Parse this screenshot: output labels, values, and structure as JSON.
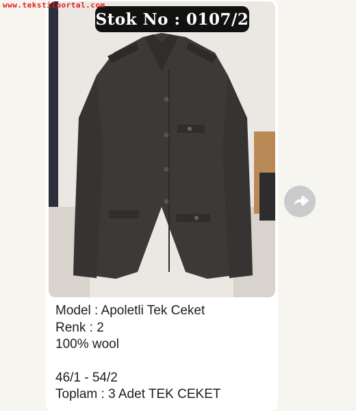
{
  "watermark": "www.tekstilportal.com",
  "post": {
    "stock_label": "Stok No : 0107/2",
    "photo_icon": "jacket-photo",
    "caption_lines": [
      "Model : Apoletli Tek Ceket",
      "Renk : 2",
      "100% wool",
      "",
      "46/1 - 54/2",
      "Toplam : 3 Adet TEK CEKET"
    ]
  },
  "actions": {
    "forward_icon": "forward-share-icon"
  },
  "colors": {
    "page_bg": "#f7f5ef",
    "card_bg": "#ffffff",
    "badge_bg": "#111111",
    "watermark": "#e21b1b",
    "jacket": "#3b3a39",
    "forward_button": "#c9cbcc"
  }
}
